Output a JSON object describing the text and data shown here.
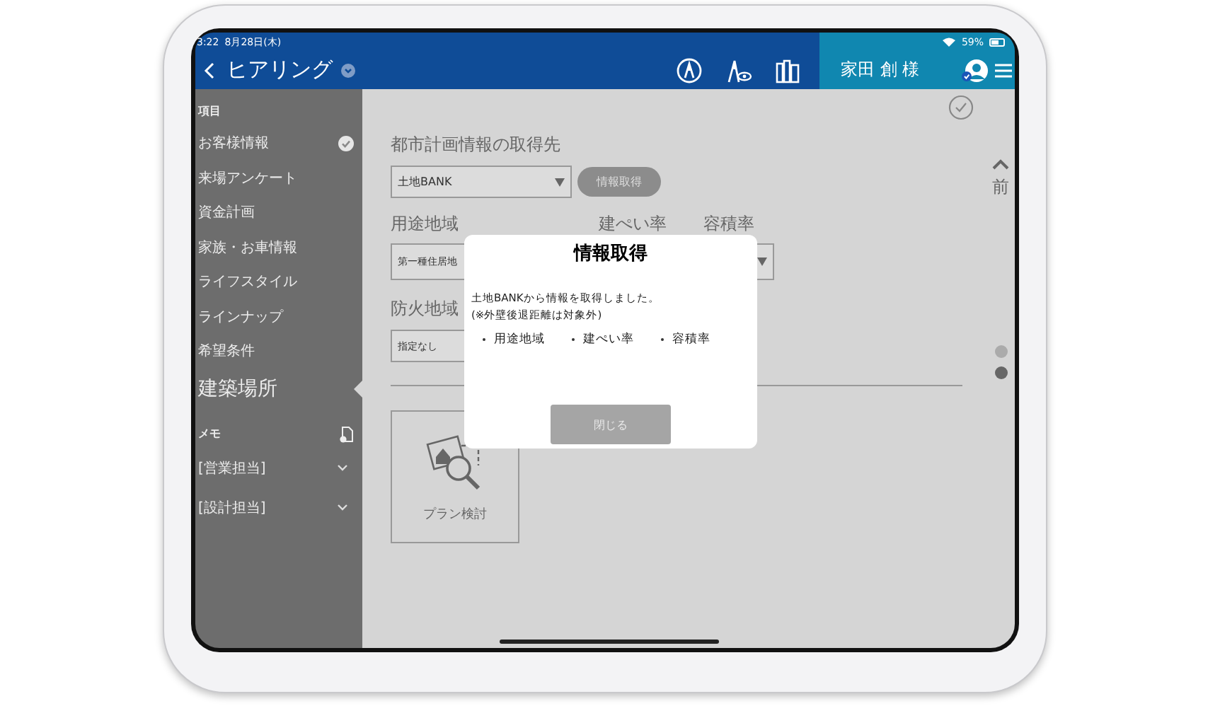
{
  "status_bar": {
    "time": "3:22",
    "date": "8月28日(木)",
    "battery": "59%"
  },
  "header": {
    "title": "ヒアリング",
    "user": "家田 創 様"
  },
  "sidebar": {
    "section": "項目",
    "items": [
      {
        "label": "お客様情報",
        "checked": true,
        "selected": false
      },
      {
        "label": "来場アンケート",
        "checked": false,
        "selected": false
      },
      {
        "label": "資金計画",
        "checked": false,
        "selected": false
      },
      {
        "label": "家族・お車情報",
        "checked": false,
        "selected": false
      },
      {
        "label": "ライフスタイル",
        "checked": false,
        "selected": false
      },
      {
        "label": "ラインナップ",
        "checked": false,
        "selected": false
      },
      {
        "label": "希望条件",
        "checked": false,
        "selected": false
      },
      {
        "label": "建築場所",
        "checked": false,
        "selected": true
      }
    ],
    "memo": {
      "label": "メモ",
      "items": [
        {
          "label": "[営業担当]",
          "expanded": false
        },
        {
          "label": "[設計担当]",
          "expanded": false
        }
      ]
    }
  },
  "main": {
    "source_label": "都市計画情報の取得先",
    "source_select": "土地BANK",
    "fetch_button": "情報取得",
    "zoning_label": "用途地域",
    "coverage_label": "建ぺい率",
    "far_label": "容積率",
    "zoning_select": "第一種住居地",
    "fire_label": "防火地域",
    "fire_select": "指定なし",
    "plan_card": "プラン検討",
    "prev_label": "前",
    "pages": [
      {
        "selected": false
      },
      {
        "selected": true
      }
    ]
  },
  "dialog": {
    "title": "情報取得",
    "message": "土地BANKから情報を取得しました。",
    "note": "(※外壁後退距離は対象外)",
    "items": [
      "用途地域",
      "建ぺい率",
      "容積率"
    ],
    "close": "閉じる"
  }
}
